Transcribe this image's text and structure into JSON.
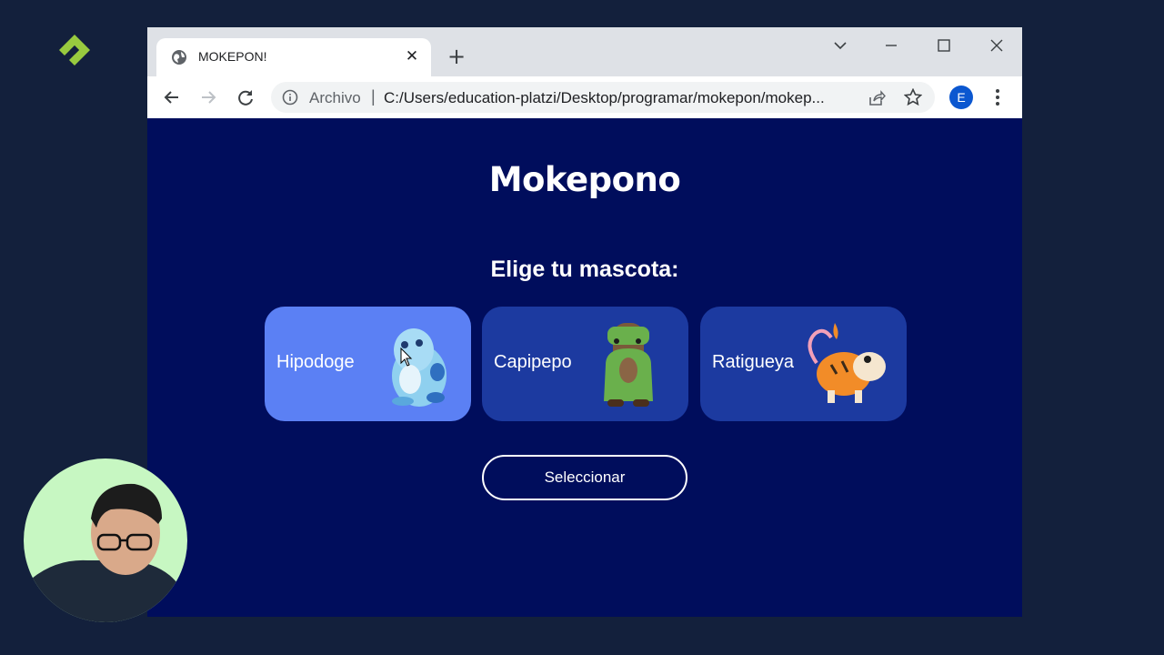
{
  "brand": {
    "logo_icon": "platzi-logo-icon",
    "color": "#98ca3f"
  },
  "browser": {
    "tab": {
      "title": "MOKEPON!",
      "favicon": "globe-icon"
    },
    "address_bar": {
      "scheme_label": "Archivo",
      "url": "C:/Users/education-platzi/Desktop/programar/mokepon/mokep..."
    },
    "profile_initial": "E"
  },
  "page": {
    "title": "Mokepono",
    "subtitle": "Elige tu mascota:",
    "pets": [
      {
        "name": "Hipodoge",
        "selected": true,
        "image": "hipodoge-image"
      },
      {
        "name": "Capipepo",
        "selected": false,
        "image": "capipepo-image"
      },
      {
        "name": "Ratigueya",
        "selected": false,
        "image": "ratigueya-image"
      }
    ],
    "select_button": "Seleccionar"
  },
  "colors": {
    "page_background": "#000d5c",
    "card": "#1c3aa0",
    "card_selected": "#5b80f4",
    "outer_background": "#13203c"
  }
}
